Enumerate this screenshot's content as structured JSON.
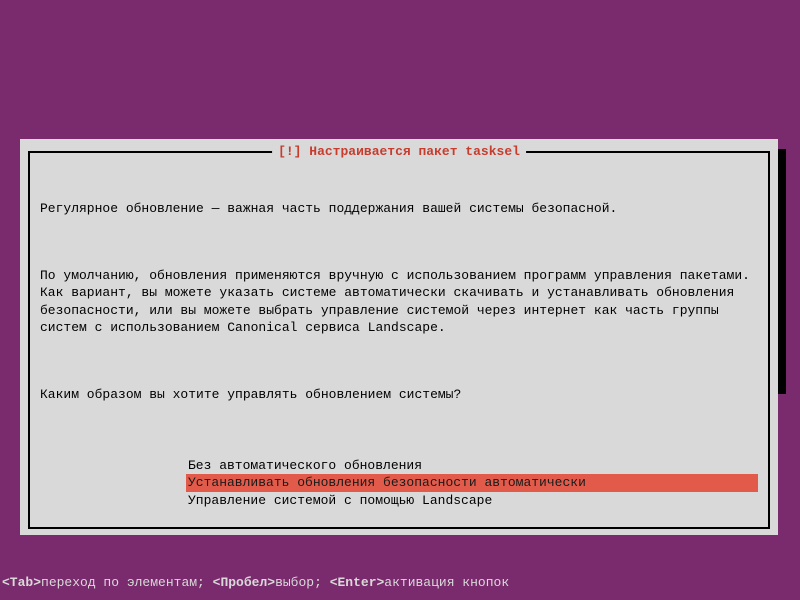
{
  "dialog": {
    "title": "[!] Настраивается пакет tasksel",
    "paragraph1": "Регулярное обновление — важная часть поддержания вашей системы безопасной.",
    "paragraph2": "По умолчанию, обновления применяются вручную с использованием программ управления пакетами. Как вариант, вы можете указать системе автоматически скачивать и устанавливать обновления безопасности, или вы можете выбрать управление системой через интернет как часть группы систем с использованием Canonical сервиса Landscape.",
    "prompt": "Каким образом вы хотите управлять обновлением системы?",
    "options": [
      {
        "label": "Без автоматического обновления",
        "selected": false
      },
      {
        "label": "Устанавливать обновления безопасности автоматически",
        "selected": true
      },
      {
        "label": "Управление системой с помощью Landscape",
        "selected": false
      }
    ]
  },
  "helpbar": {
    "tab_key": "<Tab>",
    "tab_text": "переход по элементам; ",
    "space_key": "<Пробел>",
    "space_text": "выбор; ",
    "enter_key": "<Enter>",
    "enter_text": "активация кнопок"
  }
}
